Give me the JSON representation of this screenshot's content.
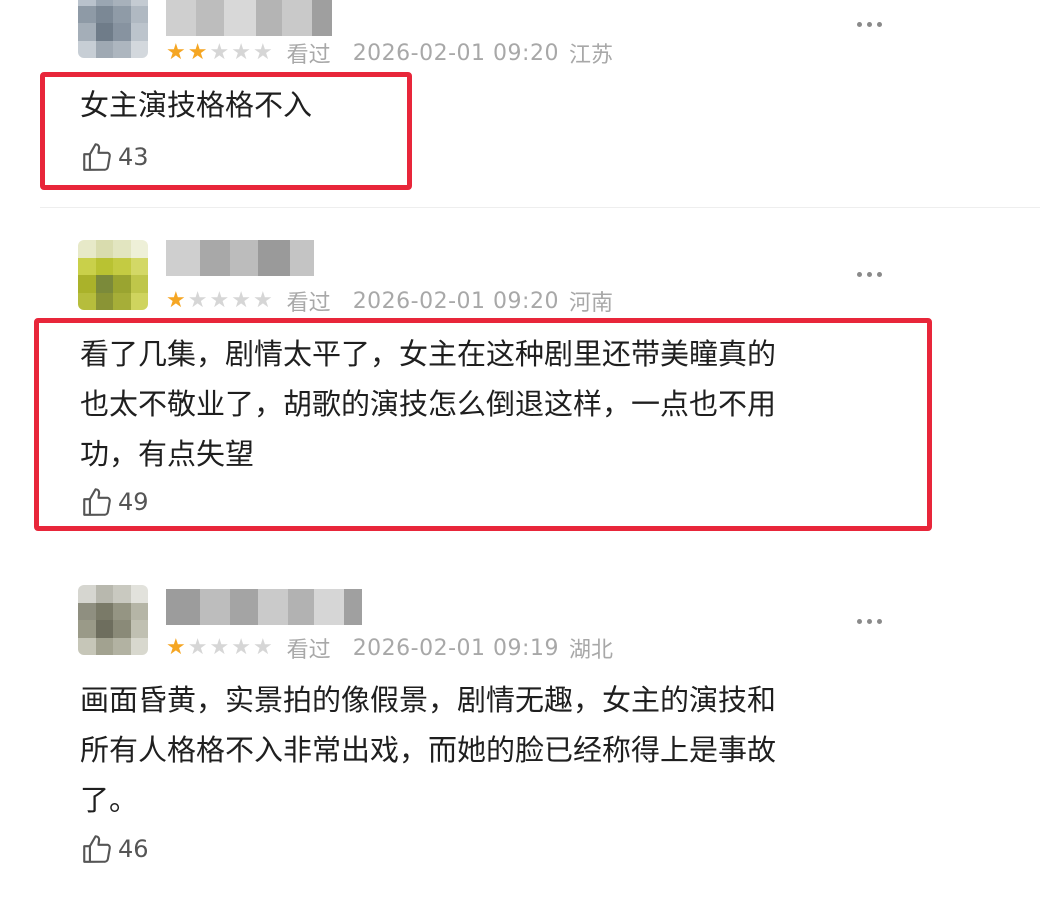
{
  "comments": [
    {
      "stars": [
        true,
        true,
        false,
        false,
        false
      ],
      "watched": "看过",
      "datetime": "2026-02-01 09:20",
      "location": "江苏",
      "lines": [
        "女主演技格格不入"
      ],
      "likes": "43"
    },
    {
      "stars": [
        true,
        false,
        false,
        false,
        false
      ],
      "watched": "看过",
      "datetime": "2026-02-01 09:20",
      "location": "河南",
      "lines": [
        "看了几集，剧情太平了，女主在这种剧里还带美瞳真的",
        "也太不敬业了，胡歌的演技怎么倒退这样，一点也不用",
        "功，有点失望"
      ],
      "likes": "49"
    },
    {
      "stars": [
        true,
        false,
        false,
        false,
        false
      ],
      "watched": "看过",
      "datetime": "2026-02-01 09:19",
      "location": "湖北",
      "lines": [
        "画面昏黄，实景拍的像假景，剧情无趣，女主的演技和",
        "所有人格格不入非常出戏，而她的脸已经称得上是事故",
        "了。"
      ],
      "likes": "46"
    }
  ],
  "colors": {
    "highlight": "#e8263a",
    "star_on": "#f5a623",
    "star_off": "#d6d6d6",
    "meta_text": "#a8a8a8"
  },
  "icons": {
    "like": "thumbs-up-icon",
    "more": "more-dots-icon",
    "star": "star-icon"
  }
}
